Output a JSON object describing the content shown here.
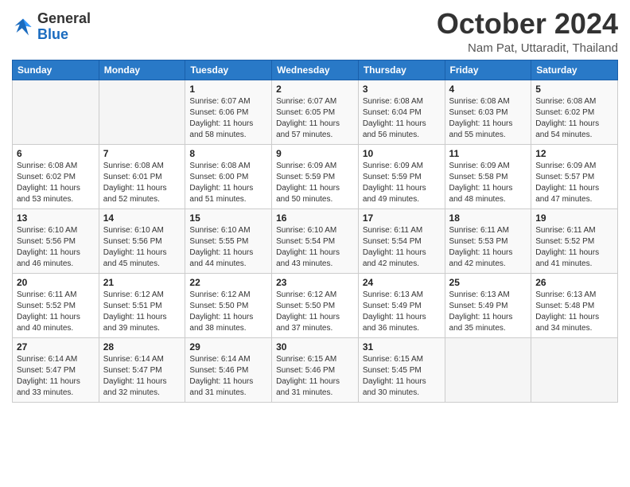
{
  "header": {
    "logo_general": "General",
    "logo_blue": "Blue",
    "month": "October 2024",
    "location": "Nam Pat, Uttaradit, Thailand"
  },
  "weekdays": [
    "Sunday",
    "Monday",
    "Tuesday",
    "Wednesday",
    "Thursday",
    "Friday",
    "Saturday"
  ],
  "weeks": [
    [
      {
        "day": "",
        "info": ""
      },
      {
        "day": "",
        "info": ""
      },
      {
        "day": "1",
        "info": "Sunrise: 6:07 AM\nSunset: 6:06 PM\nDaylight: 11 hours and 58 minutes."
      },
      {
        "day": "2",
        "info": "Sunrise: 6:07 AM\nSunset: 6:05 PM\nDaylight: 11 hours and 57 minutes."
      },
      {
        "day": "3",
        "info": "Sunrise: 6:08 AM\nSunset: 6:04 PM\nDaylight: 11 hours and 56 minutes."
      },
      {
        "day": "4",
        "info": "Sunrise: 6:08 AM\nSunset: 6:03 PM\nDaylight: 11 hours and 55 minutes."
      },
      {
        "day": "5",
        "info": "Sunrise: 6:08 AM\nSunset: 6:02 PM\nDaylight: 11 hours and 54 minutes."
      }
    ],
    [
      {
        "day": "6",
        "info": "Sunrise: 6:08 AM\nSunset: 6:02 PM\nDaylight: 11 hours and 53 minutes."
      },
      {
        "day": "7",
        "info": "Sunrise: 6:08 AM\nSunset: 6:01 PM\nDaylight: 11 hours and 52 minutes."
      },
      {
        "day": "8",
        "info": "Sunrise: 6:08 AM\nSunset: 6:00 PM\nDaylight: 11 hours and 51 minutes."
      },
      {
        "day": "9",
        "info": "Sunrise: 6:09 AM\nSunset: 5:59 PM\nDaylight: 11 hours and 50 minutes."
      },
      {
        "day": "10",
        "info": "Sunrise: 6:09 AM\nSunset: 5:59 PM\nDaylight: 11 hours and 49 minutes."
      },
      {
        "day": "11",
        "info": "Sunrise: 6:09 AM\nSunset: 5:58 PM\nDaylight: 11 hours and 48 minutes."
      },
      {
        "day": "12",
        "info": "Sunrise: 6:09 AM\nSunset: 5:57 PM\nDaylight: 11 hours and 47 minutes."
      }
    ],
    [
      {
        "day": "13",
        "info": "Sunrise: 6:10 AM\nSunset: 5:56 PM\nDaylight: 11 hours and 46 minutes."
      },
      {
        "day": "14",
        "info": "Sunrise: 6:10 AM\nSunset: 5:56 PM\nDaylight: 11 hours and 45 minutes."
      },
      {
        "day": "15",
        "info": "Sunrise: 6:10 AM\nSunset: 5:55 PM\nDaylight: 11 hours and 44 minutes."
      },
      {
        "day": "16",
        "info": "Sunrise: 6:10 AM\nSunset: 5:54 PM\nDaylight: 11 hours and 43 minutes."
      },
      {
        "day": "17",
        "info": "Sunrise: 6:11 AM\nSunset: 5:54 PM\nDaylight: 11 hours and 42 minutes."
      },
      {
        "day": "18",
        "info": "Sunrise: 6:11 AM\nSunset: 5:53 PM\nDaylight: 11 hours and 42 minutes."
      },
      {
        "day": "19",
        "info": "Sunrise: 6:11 AM\nSunset: 5:52 PM\nDaylight: 11 hours and 41 minutes."
      }
    ],
    [
      {
        "day": "20",
        "info": "Sunrise: 6:11 AM\nSunset: 5:52 PM\nDaylight: 11 hours and 40 minutes."
      },
      {
        "day": "21",
        "info": "Sunrise: 6:12 AM\nSunset: 5:51 PM\nDaylight: 11 hours and 39 minutes."
      },
      {
        "day": "22",
        "info": "Sunrise: 6:12 AM\nSunset: 5:50 PM\nDaylight: 11 hours and 38 minutes."
      },
      {
        "day": "23",
        "info": "Sunrise: 6:12 AM\nSunset: 5:50 PM\nDaylight: 11 hours and 37 minutes."
      },
      {
        "day": "24",
        "info": "Sunrise: 6:13 AM\nSunset: 5:49 PM\nDaylight: 11 hours and 36 minutes."
      },
      {
        "day": "25",
        "info": "Sunrise: 6:13 AM\nSunset: 5:49 PM\nDaylight: 11 hours and 35 minutes."
      },
      {
        "day": "26",
        "info": "Sunrise: 6:13 AM\nSunset: 5:48 PM\nDaylight: 11 hours and 34 minutes."
      }
    ],
    [
      {
        "day": "27",
        "info": "Sunrise: 6:14 AM\nSunset: 5:47 PM\nDaylight: 11 hours and 33 minutes."
      },
      {
        "day": "28",
        "info": "Sunrise: 6:14 AM\nSunset: 5:47 PM\nDaylight: 11 hours and 32 minutes."
      },
      {
        "day": "29",
        "info": "Sunrise: 6:14 AM\nSunset: 5:46 PM\nDaylight: 11 hours and 31 minutes."
      },
      {
        "day": "30",
        "info": "Sunrise: 6:15 AM\nSunset: 5:46 PM\nDaylight: 11 hours and 31 minutes."
      },
      {
        "day": "31",
        "info": "Sunrise: 6:15 AM\nSunset: 5:45 PM\nDaylight: 11 hours and 30 minutes."
      },
      {
        "day": "",
        "info": ""
      },
      {
        "day": "",
        "info": ""
      }
    ]
  ]
}
